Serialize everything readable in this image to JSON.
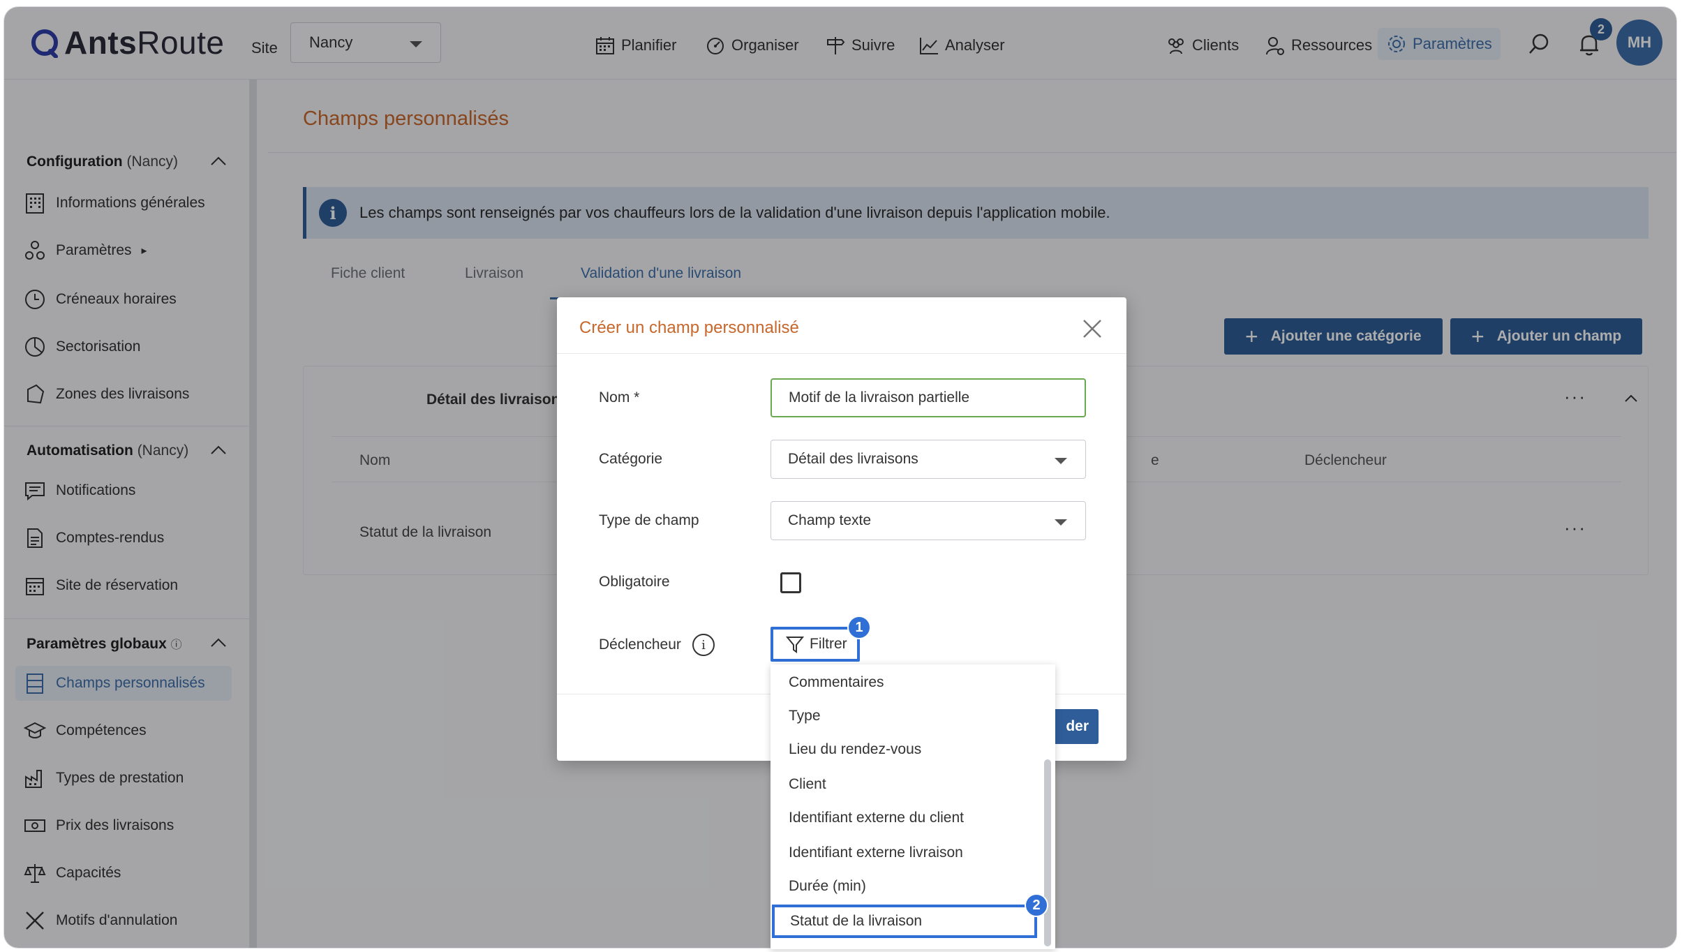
{
  "app": {
    "logo_bold": "Ants",
    "logo_light": "Route",
    "site_label": "Site",
    "site_value": "Nancy"
  },
  "nav": {
    "planifier": "Planifier",
    "organiser": "Organiser",
    "suivre": "Suivre",
    "analyser": "Analyser",
    "clients": "Clients",
    "ressources": "Ressources",
    "parametres": "Paramètres",
    "notif_count": "2",
    "avatar_initials": "MH"
  },
  "sidebar": {
    "configuration": {
      "title": "Configuration",
      "scope": "(Nancy)"
    },
    "config_items": [
      "Informations générales",
      "Paramètres",
      "Créneaux horaires",
      "Sectorisation",
      "Zones des livraisons"
    ],
    "parametres_arrow": "▸",
    "automatisation": {
      "title": "Automatisation",
      "scope": "(Nancy)"
    },
    "auto_items": [
      "Notifications",
      "Comptes-rendus",
      "Site de réservation"
    ],
    "globaux": {
      "title": "Paramètres globaux"
    },
    "global_items": [
      "Champs personnalisés",
      "Compétences",
      "Types de prestation",
      "Prix des livraisons",
      "Capacités",
      "Motifs d'annulation"
    ]
  },
  "main": {
    "page_title": "Champs personnalisés",
    "info_text": "Les champs sont renseignés par vos chauffeurs lors de la validation d'une livraison depuis l'application mobile.",
    "tabs": [
      "Fiche client",
      "Livraison",
      "Validation d'une livraison"
    ],
    "btn_add_category": "Ajouter une catégorie",
    "btn_add_field": "Ajouter un champ",
    "category_name": "Détail des livraisons",
    "col_nom": "Nom",
    "col_partial": "e",
    "col_declencheur": "Déclencheur",
    "row_1": "Statut de la livraison",
    "more": "···"
  },
  "modal": {
    "title": "Créer un champ personnalisé",
    "nom_label": "Nom *",
    "nom_value": "Motif de la livraison partielle",
    "categorie_label": "Catégorie",
    "categorie_value": "Détail des livraisons",
    "type_label": "Type de champ",
    "type_value": "Champ texte",
    "obligatoire_label": "Obligatoire",
    "declencheur_label": "Déclencheur",
    "filter_label": "Filtrer",
    "save_partial": "der",
    "step_1": "1",
    "step_2": "2"
  },
  "dropdown": {
    "items": [
      "Commentaires",
      "Type",
      "Lieu du rendez-vous",
      "Client",
      "Identifiant externe du client",
      "Identifiant externe livraison",
      "Durée (min)",
      "Statut de la livraison"
    ],
    "selected": "Statut de la livraison"
  },
  "colors": {
    "accent": "#2f5d99",
    "title_orange": "#c8672b",
    "highlight": "#2f6fd6",
    "focus_green": "#6aa84f"
  }
}
